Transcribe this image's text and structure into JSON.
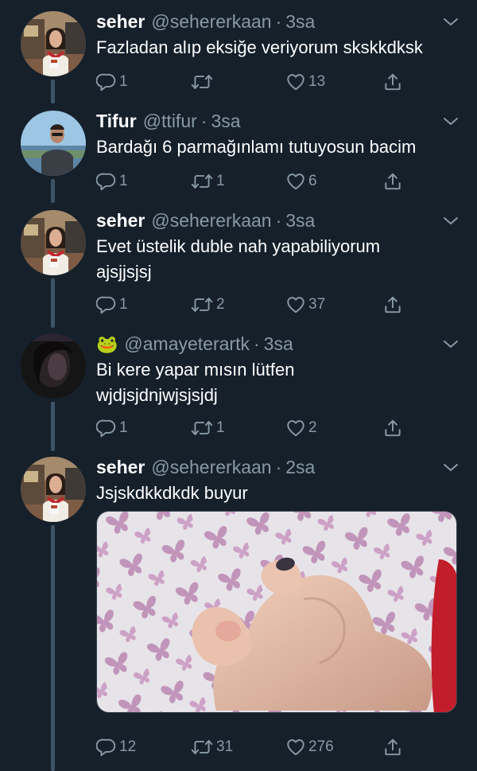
{
  "tweets": [
    {
      "name": "seher",
      "handle": "@sehererkaan",
      "dot": "·",
      "time": "3sa",
      "text": "Fazladan alıp eksiğe veriyorum skskkdksk",
      "replies": "1",
      "retweets": "",
      "likes": "13"
    },
    {
      "name": "Tifur",
      "handle": "@ttifur",
      "dot": "·",
      "time": "3sa",
      "text": "Bardağı 6 parmağınlamı tutuyosun bacim",
      "replies": "1",
      "retweets": "1",
      "likes": "6"
    },
    {
      "name": "seher",
      "handle": "@sehererkaan",
      "dot": "·",
      "time": "3sa",
      "text": "Evet üstelik duble nah yapabiliyorum ajsjjsjsj",
      "replies": "1",
      "retweets": "2",
      "likes": "37"
    },
    {
      "name": "🐸",
      "handle": "@amayeterartk",
      "dot": "·",
      "time": "3sa",
      "text": "Bi kere yapar mısın lütfen wjdjsjdnjwjsjsjdj",
      "replies": "1",
      "retweets": "1",
      "likes": "2"
    },
    {
      "name": "seher",
      "handle": "@sehererkaan",
      "dot": "·",
      "time": "2sa",
      "text": "Jsjskdkkdkdk buyur",
      "replies": "12",
      "retweets": "31",
      "likes": "276"
    }
  ],
  "icons": {
    "reply": "reply-icon",
    "retweet": "retweet-icon",
    "like": "heart-icon",
    "share": "share-icon",
    "caret": "chevron-down-icon"
  },
  "colors": {
    "background": "#15202b",
    "secondary_text": "#8899a6",
    "thread_line": "#3d5466"
  }
}
